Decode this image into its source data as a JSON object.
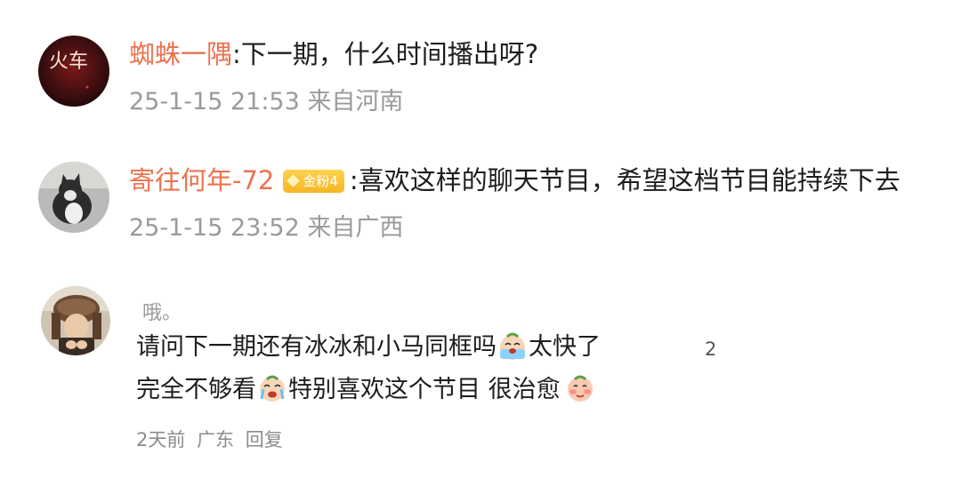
{
  "comments": [
    {
      "username": "蜘蛛一隅",
      "text": ":下一期，什么时间播出呀?",
      "meta": "25-1-15 21:53 来自河南",
      "avatar_text": "火车"
    },
    {
      "username": "寄往何年-72",
      "badge": "金粉4",
      "text": ":喜欢这样的聊天节目，希望这档节目能持续下去",
      "meta": "25-1-15 23:52 来自广西"
    },
    {
      "username": "哦。",
      "line1": "请问下一期还有冰冰和小马同框吗",
      "line1_after": "太快了",
      "line2_a": "完全不够看",
      "line2_b": "特别喜欢这个节目 很治愈",
      "like_count": "2",
      "time": "2天前",
      "location": "广东",
      "reply_label": "回复"
    }
  ],
  "colors": {
    "username": "#eb7350",
    "meta": "#9a9a9a",
    "badge": "#f6b524"
  }
}
